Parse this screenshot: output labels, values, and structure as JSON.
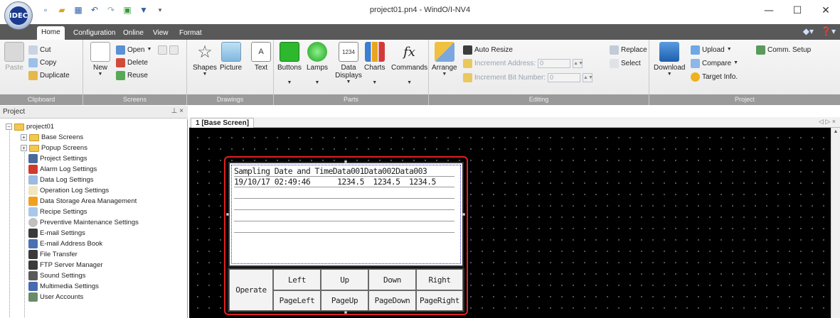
{
  "window": {
    "title": "project01.pn4 - WindO/I-NV4",
    "logo_text": "IDEC",
    "controls": [
      "—",
      "☐",
      "✕"
    ]
  },
  "quick_access": [
    "new-icon",
    "open-icon",
    "save-icon",
    "undo-icon",
    "redo-icon",
    "screen-icon",
    "dropdown-icon"
  ],
  "ribbon_tabs": [
    "Home",
    "Configuration",
    "Online",
    "View",
    "Format"
  ],
  "ribbon": {
    "clipboard": {
      "title": "Clipboard",
      "paste": "Paste",
      "cut": "Cut",
      "copy": "Copy",
      "duplicate": "Duplicate"
    },
    "screens": {
      "title": "Screens",
      "new": "New",
      "open": "Open",
      "delete": "Delete",
      "reuse": "Reuse"
    },
    "drawings": {
      "title": "Drawings",
      "shapes": "Shapes",
      "picture": "Picture",
      "text": "Text"
    },
    "parts": {
      "title": "Parts",
      "buttons": "Buttons",
      "lamps": "Lamps",
      "data_displays": "Data Displays",
      "charts": "Charts",
      "commands": "Commands",
      "data_display_icon_text": "1234",
      "commands_icon_text": "fx"
    },
    "editing": {
      "title": "Editing",
      "arrange": "Arrange",
      "auto_resize": "Auto Resize",
      "increment_address": "Increment Address:",
      "increment_address_value": "0",
      "increment_bit": "Increment Bit Number:",
      "increment_bit_value": "0",
      "replace": "Replace",
      "select": "Select"
    },
    "project": {
      "title": "Project",
      "download": "Download",
      "upload": "Upload",
      "compare": "Compare",
      "target_info": "Target Info.",
      "comm_setup": "Comm. Setup"
    }
  },
  "project_pane": {
    "title": "Project",
    "tree": [
      "project01",
      "Base Screens",
      "Popup Screens",
      "Project Settings",
      "Alarm Log Settings",
      "Data Log Settings",
      "Operation Log Settings",
      "Data Storage Area Management",
      "Recipe Settings",
      "Preventive Maintenance Settings",
      "E-mail Settings",
      "E-mail Address Book",
      "File Transfer",
      "FTP Server Manager",
      "Sound Settings",
      "Multimedia Settings",
      "User Accounts"
    ]
  },
  "editor": {
    "tab": "1 [Base Screen]"
  },
  "data_log": {
    "header": "Sampling Date and TimeData001Data002Data003",
    "row1": "19/10/17 02:49:46      1234.5  1234.5  1234.5",
    "buttons": {
      "operate": "Operate",
      "left": "Left",
      "up": "Up",
      "down": "Down",
      "right": "Right",
      "page_left": "PageLeft",
      "page_up": "PageUp",
      "page_down": "PageDown",
      "page_right": "PageRight"
    }
  },
  "colors": {
    "selection_frame": "#e02020",
    "canvas": "#000000",
    "tab_bar": "#595959"
  }
}
